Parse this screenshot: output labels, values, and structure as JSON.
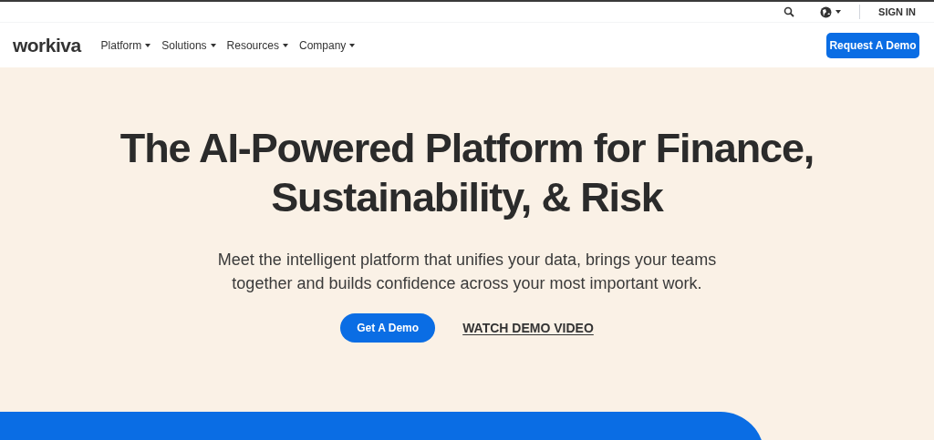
{
  "utility_bar": {
    "sign_in": "SIGN IN"
  },
  "nav": {
    "logo": "workiva",
    "menus": [
      "Platform",
      "Solutions",
      "Resources",
      "Company"
    ],
    "cta": "Request A Demo"
  },
  "hero": {
    "title_lines": [
      "The AI-Powered Platform for Finance,",
      "Sustainability, & Risk"
    ],
    "subtitle_lines": [
      "Meet the intelligent platform that unifies your data, brings your teams",
      "together and builds confidence across your most important work."
    ],
    "primary_button": "Get A Demo",
    "secondary_link": "WATCH DEMO VIDEO"
  }
}
